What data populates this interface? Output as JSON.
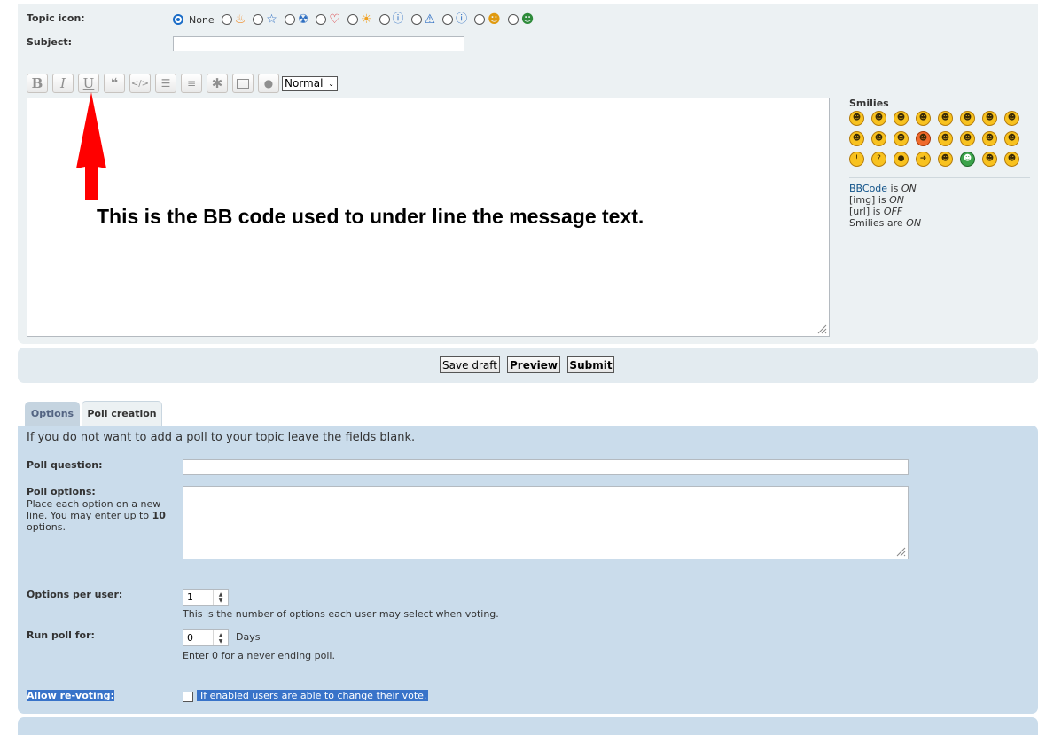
{
  "topic": {
    "label": "Topic icon:",
    "none_label": "None",
    "icons": [
      "flame-icon",
      "star-icon",
      "radioactive-icon",
      "heart-icon",
      "star-burst-icon",
      "question-icon",
      "warning-icon",
      "info-icon",
      "smile-icon",
      "grin-icon"
    ]
  },
  "subject": {
    "label": "Subject:",
    "value": ""
  },
  "toolbar": {
    "bold": "B",
    "italic": "I",
    "underline": "U",
    "fontsize": "Normal"
  },
  "editor": {
    "annotation": "This is the BB code used to under line the message text."
  },
  "smilies": {
    "title": "Smilies",
    "bbcode_link": "BBCode",
    "bbcode_is": " is ",
    "bbcode_state": "ON",
    "img_label": "[img] is ",
    "img_state": "ON",
    "url_label": "[url] is ",
    "url_state": "OFF",
    "smilies_label": "Smilies are ",
    "smilies_state": "ON"
  },
  "buttons": {
    "save_draft": "Save draft",
    "preview": "Preview",
    "submit": "Submit"
  },
  "tabs": {
    "options": "Options",
    "poll_creation": "Poll creation"
  },
  "poll": {
    "note": "If you do not want to add a poll to your topic leave the fields blank.",
    "question_label": "Poll question:",
    "options_label": "Poll options:",
    "options_help_1": "Place each option on a new",
    "options_help_2": "line. You may enter up to ",
    "options_help_max": "10",
    "options_help_3": "options.",
    "per_user_label": "Options per user:",
    "per_user_value": "1",
    "per_user_explain": "This is the number of options each user may select when voting.",
    "run_label": "Run poll for:",
    "run_value": "0",
    "run_unit": "Days",
    "run_explain": "Enter 0 for a never ending poll.",
    "revote_label": "Allow re-voting:",
    "revote_explain": "If enabled users are able to change their vote."
  },
  "colors": {
    "accent": "#1a6cc7",
    "panel": "#cadceb",
    "link": "#105289",
    "arrow": "#ff0000"
  }
}
